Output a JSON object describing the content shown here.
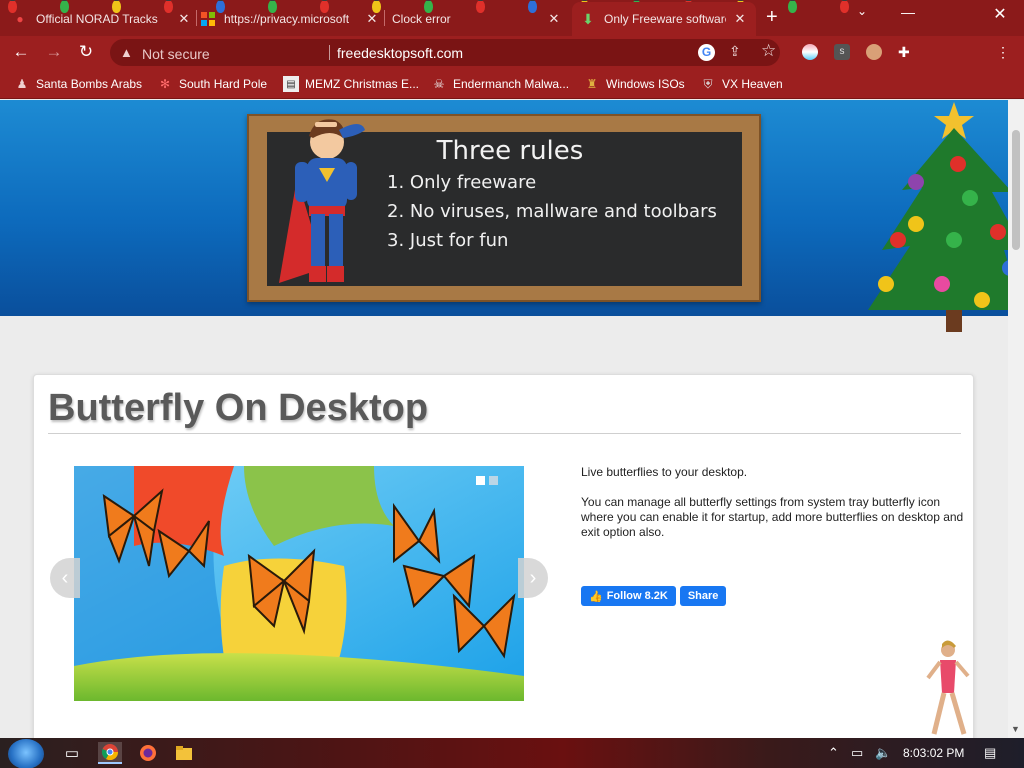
{
  "browser": {
    "tabs": [
      {
        "title": "Official NORAD Tracks",
        "icon": "ornament-icon"
      },
      {
        "title": "https://privacy.microsoft",
        "icon": "microsoft-icon"
      },
      {
        "title": "Clock error",
        "icon": "ornament-icon"
      },
      {
        "title": "Only Freeware software",
        "icon": "download-arrow-icon"
      }
    ],
    "security_label": "Not secure",
    "url": "freedesktopsoft.com",
    "bookmarks": [
      {
        "label": "Santa Bombs Arabs",
        "icon": "santa-icon"
      },
      {
        "label": "South Hard Pole",
        "icon": "snowflake-icon"
      },
      {
        "label": "MEMZ Christmas E...",
        "icon": "page-icon"
      },
      {
        "label": "Endermanch Malwa...",
        "icon": "skull-icon"
      },
      {
        "label": "Windows ISOs",
        "icon": "figure-icon"
      },
      {
        "label": "VX Heaven",
        "icon": "shield-icon"
      }
    ],
    "accent": "#9c1f1f"
  },
  "banner": {
    "title": "Three rules",
    "rules": [
      "1. Only freeware",
      "2. No viruses, mallware and toolbars",
      "3. Just for fun"
    ]
  },
  "article": {
    "title": "Butterfly On Desktop",
    "paragraphs": [
      "Live butterflies to your desktop.",
      "You can manage all butterfly settings from system tray butterfly icon where you can enable it for startup, add more butterflies on desktop and exit option also."
    ],
    "follow_label": "Follow 8.2K",
    "share_label": "Share"
  },
  "taskbar": {
    "time": "8:03:02 PM"
  }
}
